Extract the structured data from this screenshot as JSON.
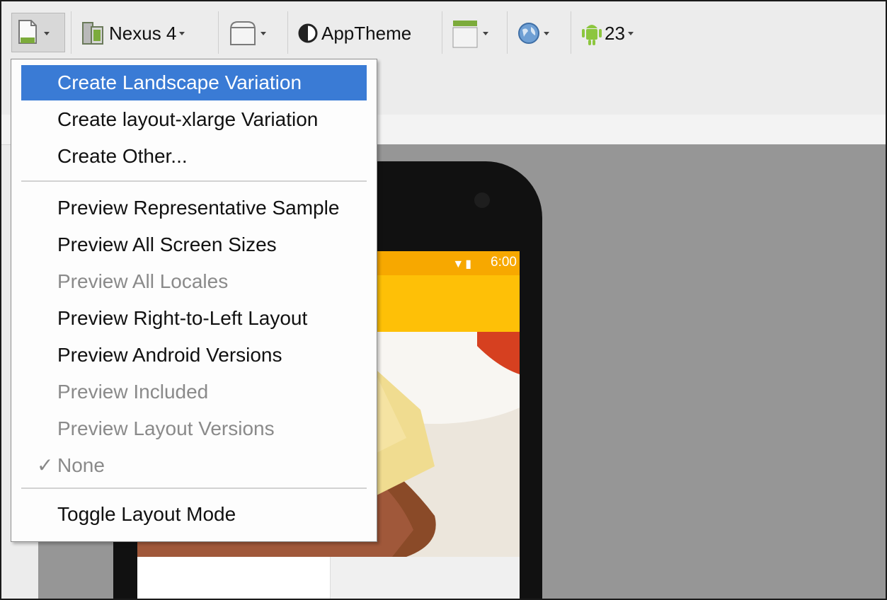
{
  "toolbar": {
    "device_name": "Nexus 4",
    "theme_name": "AppTheme",
    "api_level": "23"
  },
  "phone": {
    "status_time": "6:00"
  },
  "menu": {
    "items": [
      {
        "label": "Create Landscape Variation",
        "state": "selected"
      },
      {
        "label": "Create layout-xlarge Variation",
        "state": "enabled"
      },
      {
        "label": "Create Other...",
        "state": "enabled"
      },
      {
        "label": "Preview Representative Sample",
        "state": "enabled"
      },
      {
        "label": "Preview All Screen Sizes",
        "state": "enabled"
      },
      {
        "label": "Preview All Locales",
        "state": "disabled"
      },
      {
        "label": "Preview Right-to-Left Layout",
        "state": "enabled"
      },
      {
        "label": "Preview Android Versions",
        "state": "enabled"
      },
      {
        "label": "Preview Included",
        "state": "disabled"
      },
      {
        "label": "Preview Layout Versions",
        "state": "disabled"
      },
      {
        "label": "None",
        "state": "checked-disabled"
      },
      {
        "label": "Toggle Layout Mode",
        "state": "enabled"
      }
    ]
  },
  "colors": {
    "selection": "#3a7bd5",
    "status_bar": "#f7a800",
    "action_bar": "#fec007"
  }
}
